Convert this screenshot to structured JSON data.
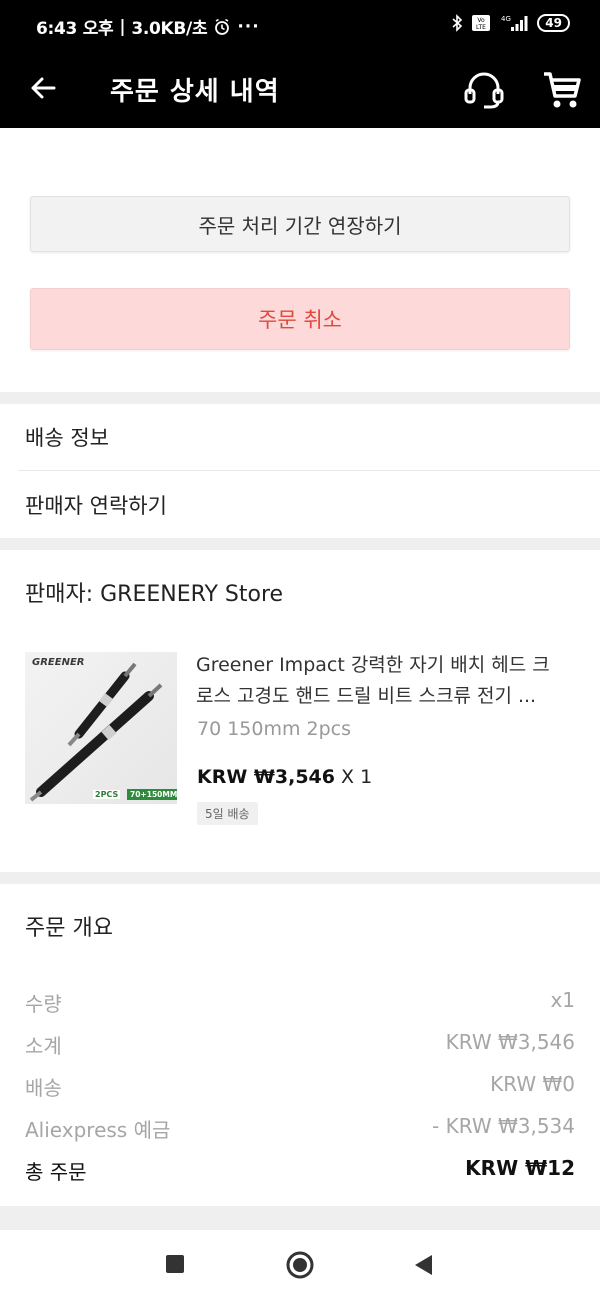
{
  "status_bar": {
    "time": "6:43 오후",
    "speed": "3.0KB/초",
    "battery": "49",
    "icons": [
      "alarm-icon",
      "more-icon",
      "bluetooth-icon",
      "volte-icon",
      "signal-icon",
      "battery-icon"
    ]
  },
  "header": {
    "title": "주문 상세 내역",
    "icons": [
      "back-arrow-icon",
      "headset-icon",
      "cart-icon"
    ]
  },
  "actions": {
    "extend_label": "주문 처리 기간 연장하기",
    "cancel_label": "주문 취소"
  },
  "links": {
    "shipping_info": "배송 정보",
    "contact_seller": "판매자 연락하기"
  },
  "store": {
    "seller_label": "판매자: GREENERY Store",
    "product": {
      "image_brand": "GREENER",
      "image_pcs": "2PCS",
      "image_size": "70+150MM",
      "title_line1": "Greener Impact 강력한 자기 배치 헤드 크",
      "title_line2": "로스 고경도 핸드 드릴 비트 스크류 전기 ...",
      "variant": "70 150mm 2pcs",
      "price": "KRW ₩3,546",
      "qty": "X 1",
      "shipping_badge": "5일 배송"
    }
  },
  "summary": {
    "title": "주문 개요",
    "rows": [
      {
        "label": "수량",
        "value": "x1"
      },
      {
        "label": "소계",
        "value": "KRW ₩3,546"
      },
      {
        "label": "배송",
        "value": "KRW ₩0"
      },
      {
        "label": "Aliexpress 예금",
        "value": "- KRW ₩3,534"
      }
    ],
    "total_label": "총 주문",
    "total_value": "KRW ₩12"
  },
  "colors": {
    "header_bg": "#000000",
    "cancel_bg": "#fdd9d9",
    "cancel_text": "#e0493e",
    "page_bg": "#efefef"
  }
}
